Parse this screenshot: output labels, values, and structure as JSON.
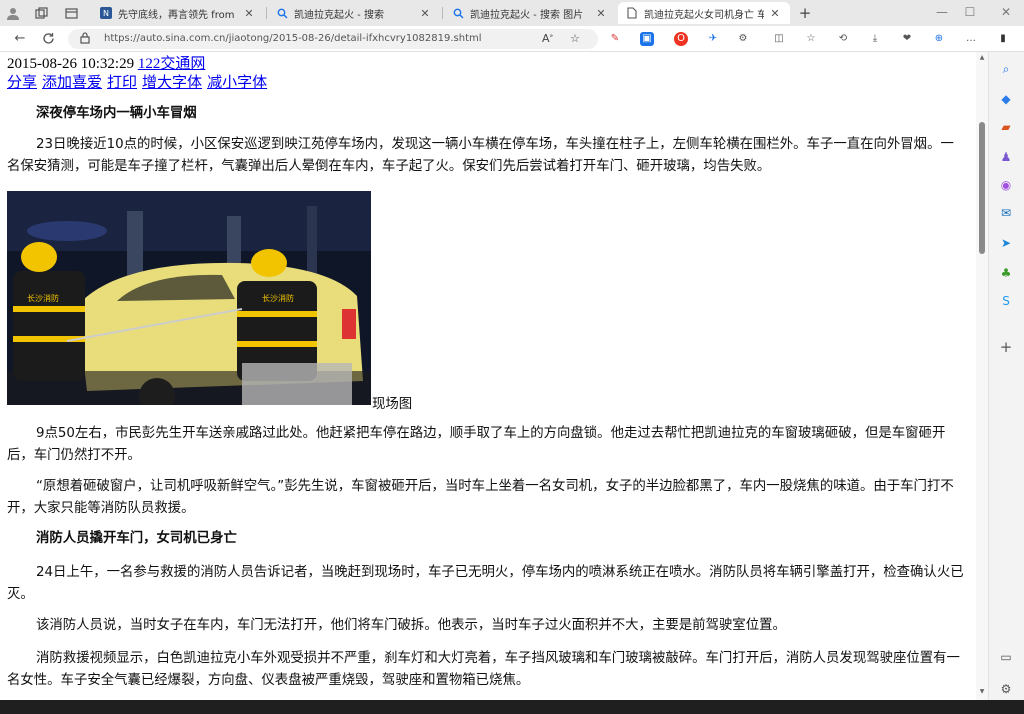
{
  "tabs": [
    {
      "title": "先守底线，再言领先 from 凯迪拉",
      "icon": "site-icon",
      "active": false
    },
    {
      "title": "凯迪拉克起火 - 搜索",
      "icon": "search-icon",
      "active": false
    },
    {
      "title": "凯迪拉克起火 - 搜索 图片",
      "icon": "search-icon",
      "active": false
    },
    {
      "title": "凯迪拉克起火女司机身亡 车外有",
      "icon": "page-icon",
      "active": true
    }
  ],
  "address": {
    "url": "https://auto.sina.com.cn/jiaotong/2015-08-26/detail-ifxhcvry1082819.shtml"
  },
  "article": {
    "datetime": "2015-08-26 10:32:29",
    "source": "122交通网",
    "actions": [
      "分享",
      "添加喜爱",
      "打印",
      "增大字体",
      "减小字体"
    ],
    "heading1": "深夜停车场内一辆小车冒烟",
    "para1": "23日晚接近10点的时候，小区保安巡逻到映江苑停车场内，发现这一辆小车横在停车场，车头撞在柱子上，左侧车轮横在围栏外。车子一直在向外冒烟。一名保安猜测，可能是车子撞了栏杆，气囊弹出后人晕倒在车内，车子起了火。保安们先后尝试着打开车门、砸开玻璃，均告失败。",
    "photo_text": "长沙消防",
    "caption": "现场图",
    "para2": "9点50左右，市民彭先生开车送亲戚路过此处。他赶紧把车停在路边，顺手取了车上的方向盘锁。他走过去帮忙把凯迪拉克的车窗玻璃砸破，但是车窗砸开后，车门仍然打不开。",
    "para3": "“原想着砸破窗户，让司机呼吸新鲜空气。”彭先生说，车窗被砸开后，当时车上坐着一名女司机，女子的半边脸都黑了，车内一股烧焦的味道。由于车门打不开，大家只能等消防队员救援。",
    "heading2": "消防人员撬开车门，女司机已身亡",
    "para4": "24日上午，一名参与救援的消防人员告诉记者，当晚赶到现场时，车子已无明火，停车场内的喷淋系统正在喷水。消防队员将车辆引擎盖打开，检查确认火已灭。",
    "para5": "该消防人员说，当时女子在车内，车门无法打开，他们将车门破拆。他表示，当时车子过火面积并不大，主要是前驾驶室位置。",
    "para6": "消防救援视频显示，白色凯迪拉克小车外观受损并不严重，刹车灯和大灯亮着，车子挡风玻璃和车门玻璃被敲碎。车门打开后，消防人员发现驾驶座位置有一名女性。车子安全气囊已经爆裂，方向盘、仪表盘被严重烧毁，驾驶座和置物箱已烧焦。"
  },
  "colors": {
    "link": "#0000ee",
    "car": "#e8dd7a",
    "uniform": "#1b1b1b",
    "helmet": "#f2c400"
  }
}
